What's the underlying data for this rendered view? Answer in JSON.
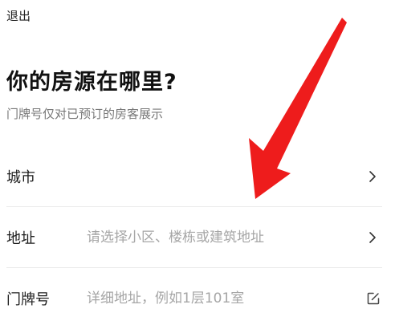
{
  "header": {
    "exit_label": "退出"
  },
  "main": {
    "title": "你的房源在哪里?",
    "subtitle": "门牌号仅对已预订的房客展示"
  },
  "form": {
    "city": {
      "label": "城市"
    },
    "address": {
      "label": "地址",
      "placeholder": "请选择小区、楼栋或建筑地址"
    },
    "door_number": {
      "label": "门牌号",
      "placeholder": "详细地址，例如1层101室"
    }
  },
  "icons": {
    "chevron": "chevron-right-icon",
    "edit": "edit-icon"
  },
  "colors": {
    "annotation_arrow": "#ee1c1c",
    "placeholder": "#a6a6a6"
  }
}
